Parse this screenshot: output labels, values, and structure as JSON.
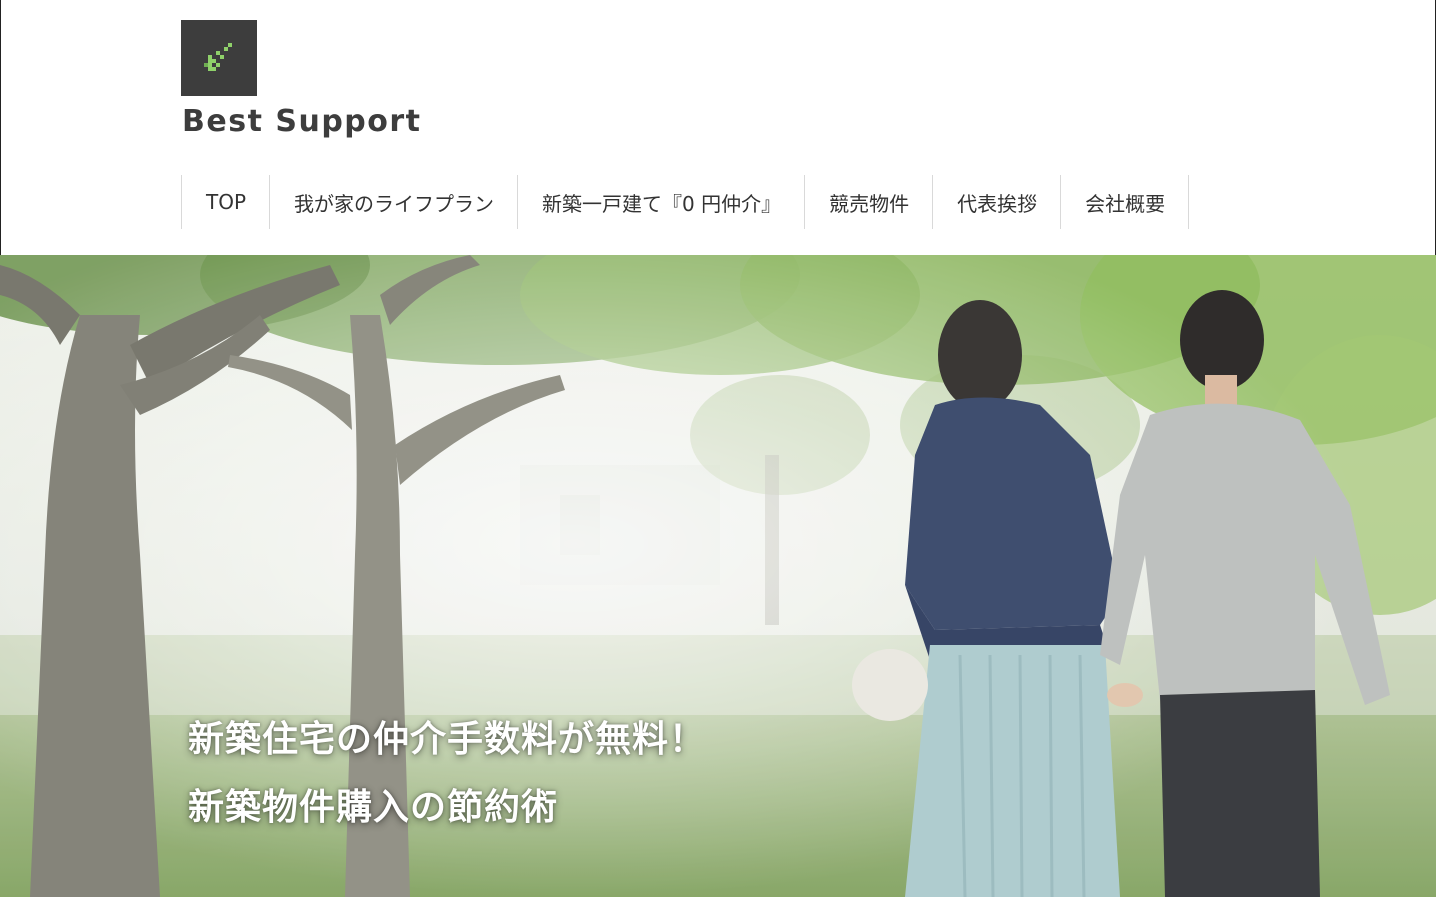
{
  "site": {
    "title": "Best Support",
    "logo_icon": "pixel-stairs-logo"
  },
  "nav": {
    "items": [
      {
        "label": "TOP"
      },
      {
        "label": "我が家のライフプラン"
      },
      {
        "label": "新築一戸建て『0 円仲介』"
      },
      {
        "label": "競売物件"
      },
      {
        "label": "代表挨拶"
      },
      {
        "label": "会社概要"
      }
    ]
  },
  "hero": {
    "headline_1": "新築住宅の仲介手数料が無料！",
    "headline_2": "新築物件購入の節約術"
  },
  "colors": {
    "logo_bg": "#3d3d3d",
    "logo_accent": "#8fd16a",
    "title_text": "#3d3d3d",
    "nav_divider": "#d9d9d9",
    "hero_text": "#ffffff"
  }
}
